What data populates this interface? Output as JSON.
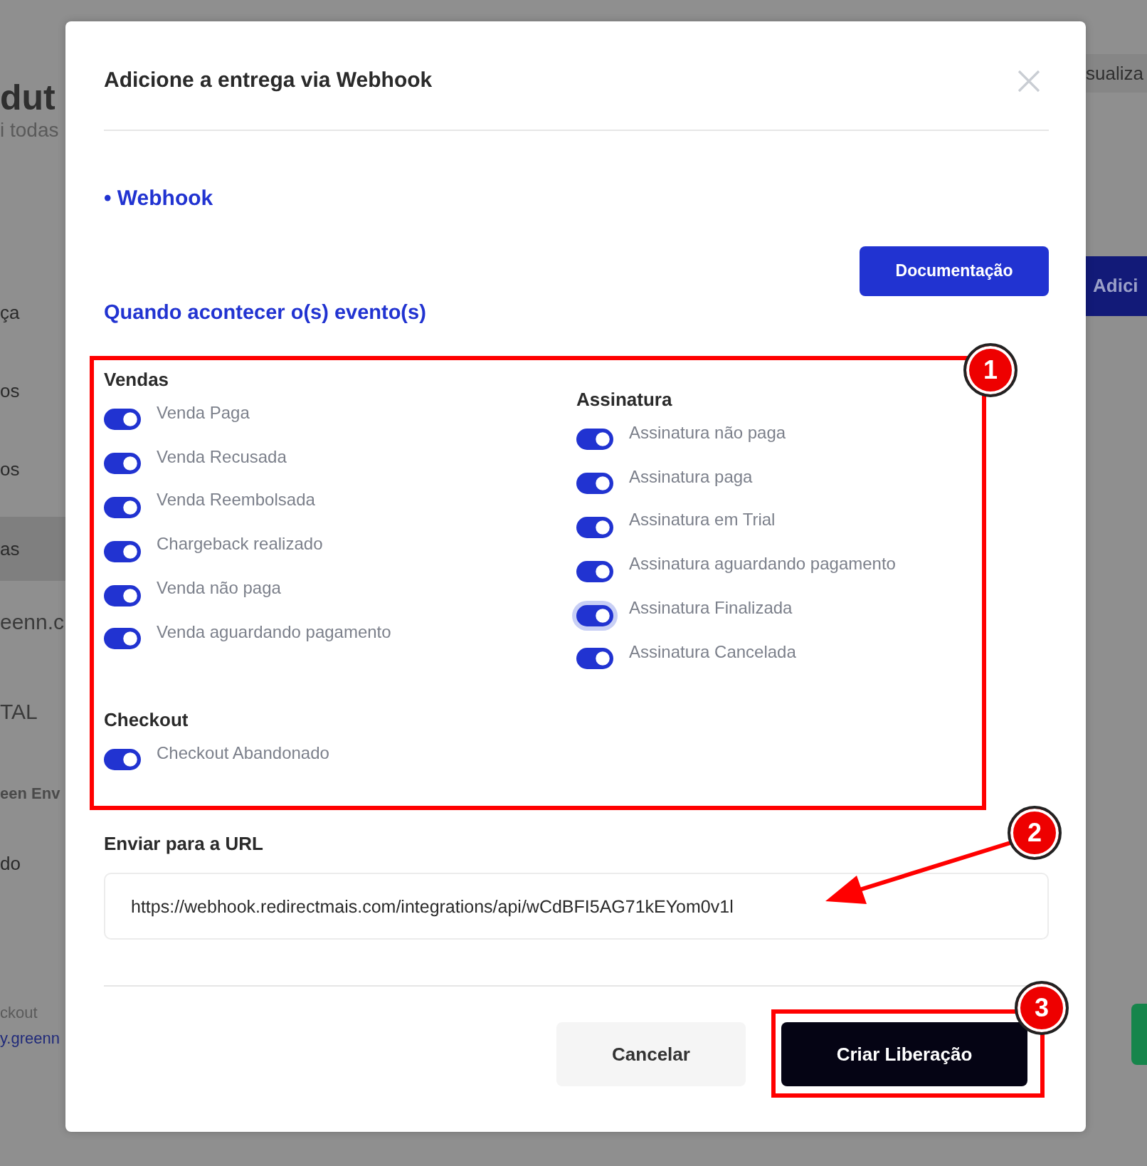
{
  "background_page": {
    "left": [
      {
        "text": "dut",
        "kind": "title"
      },
      {
        "text": "i todas",
        "kind": "subtitle"
      },
      {
        "text": "ça",
        "kind": "menu",
        "selected": false
      },
      {
        "text": "os",
        "kind": "menu",
        "selected": false
      },
      {
        "text": "os",
        "kind": "menu",
        "selected": false
      },
      {
        "text": "as",
        "kind": "menu",
        "selected": true
      },
      {
        "text": "eenn.c",
        "kind": "logo"
      },
      {
        "text": "TAL",
        "kind": "logo"
      },
      {
        "text": "een Env",
        "kind": "bold"
      },
      {
        "text": "do",
        "kind": "menu",
        "selected": false
      },
      {
        "text": "ckout",
        "kind": "small"
      },
      {
        "text": "y.greenn",
        "kind": "link"
      }
    ],
    "right": [
      {
        "text": "sualiza",
        "kind": "light_button"
      },
      {
        "text": "Adici",
        "kind": "primary_button"
      },
      {
        "kind": "success_button"
      }
    ]
  },
  "modal": {
    "title": "Adicione a entrega via Webhook",
    "integration": "• Webhook",
    "doc_button": "Documentação",
    "events_heading": "Quando acontecer o(s) evento(s)",
    "groups": [
      {
        "title": "Vendas",
        "events": [
          {
            "label": "Venda Paga",
            "checked": true,
            "focused": false
          },
          {
            "label": "Venda Recusada",
            "checked": true,
            "focused": false
          },
          {
            "label": "Venda Reembolsada",
            "checked": true,
            "focused": false
          },
          {
            "label": "Chargeback realizado",
            "checked": true,
            "focused": false
          },
          {
            "label": "Venda não paga",
            "checked": true,
            "focused": false
          },
          {
            "label": "Venda aguardando pagamento",
            "checked": true,
            "focused": false
          }
        ]
      },
      {
        "title": "Assinatura",
        "events": [
          {
            "label": "Assinatura não paga",
            "checked": true,
            "focused": false
          },
          {
            "label": "Assinatura paga",
            "checked": true,
            "focused": false
          },
          {
            "label": "Assinatura em Trial",
            "checked": true,
            "focused": false
          },
          {
            "label": "Assinatura aguardando pagamento",
            "checked": true,
            "focused": false
          },
          {
            "label": "Assinatura Finalizada",
            "checked": true,
            "focused": true
          },
          {
            "label": "Assinatura Cancelada",
            "checked": true,
            "focused": false
          }
        ]
      },
      {
        "title": "Checkout",
        "events": [
          {
            "label": "Checkout Abandonado",
            "checked": true,
            "focused": false
          }
        ]
      }
    ],
    "url_label": "Enviar para a URL",
    "url_value": "https://webhook.redirectmais.com/integrations/api/wCdBFI5AG71kEYom0v1l",
    "buttons": [
      {
        "label": "Cancelar",
        "kind": "secondary"
      },
      {
        "label": "Criar Liberação",
        "kind": "primary"
      }
    ]
  },
  "annotations": [
    {
      "label": "1",
      "kind": "box"
    },
    {
      "label": "2",
      "kind": "arrow"
    },
    {
      "label": "3",
      "kind": "box"
    }
  ]
}
